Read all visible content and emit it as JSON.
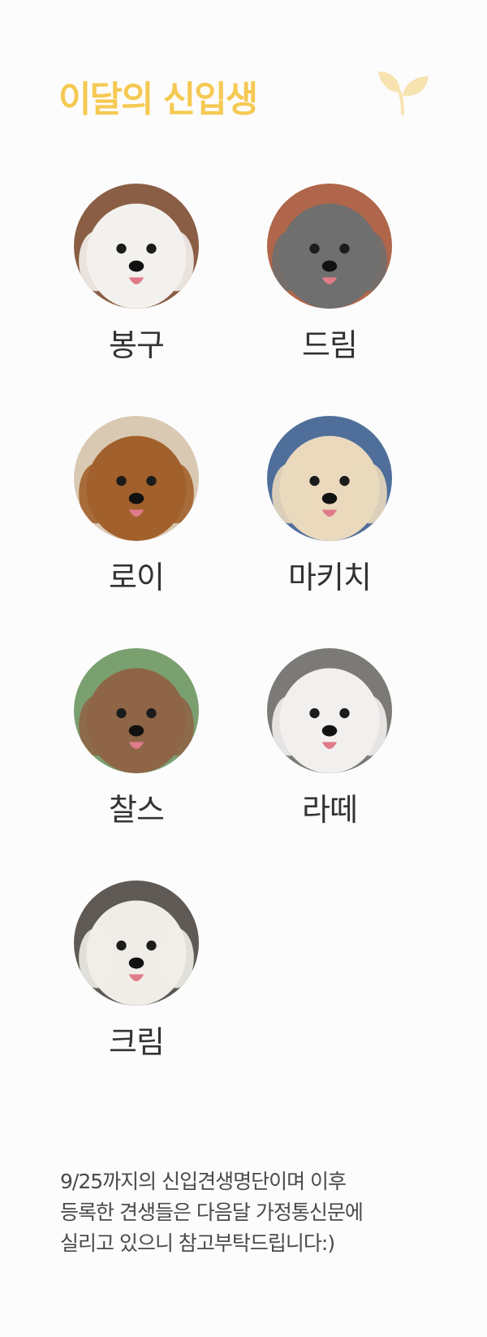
{
  "header": {
    "title": "이달의 신입생",
    "icon": "sprout-icon",
    "accent_color": "#f5c953"
  },
  "dogs": [
    {
      "name": "봉구",
      "photo": "white-bichon-photo",
      "fur": "#f3f1ee",
      "bg": "#8a5e44"
    },
    {
      "name": "드림",
      "photo": "gray-poodle-photo",
      "fur": "#6f6f6f",
      "bg": "#b0664a"
    },
    {
      "name": "로이",
      "photo": "brown-spaniel-photo",
      "fur": "#a2612c",
      "bg": "#d9c9b3"
    },
    {
      "name": "마키치",
      "photo": "cream-cocker-spaniel-photo",
      "fur": "#ead9bd",
      "bg": "#4f6f9a"
    },
    {
      "name": "찰스",
      "photo": "brown-poodle-photo",
      "fur": "#8e6547",
      "bg": "#7aa070"
    },
    {
      "name": "라떼",
      "photo": "white-bichon-photo",
      "fur": "#f2f0ee",
      "bg": "#7c7a77"
    },
    {
      "name": "크림",
      "photo": "white-maltese-photo",
      "fur": "#f0ede8",
      "bg": "#5f5a55"
    }
  ],
  "footer": {
    "lines": [
      "9/25까지의 신입견생명단이며 이후",
      "등록한 견생들은 다음달 가정통신문에",
      "실리고 있으니 참고부탁드립니다:)"
    ]
  }
}
